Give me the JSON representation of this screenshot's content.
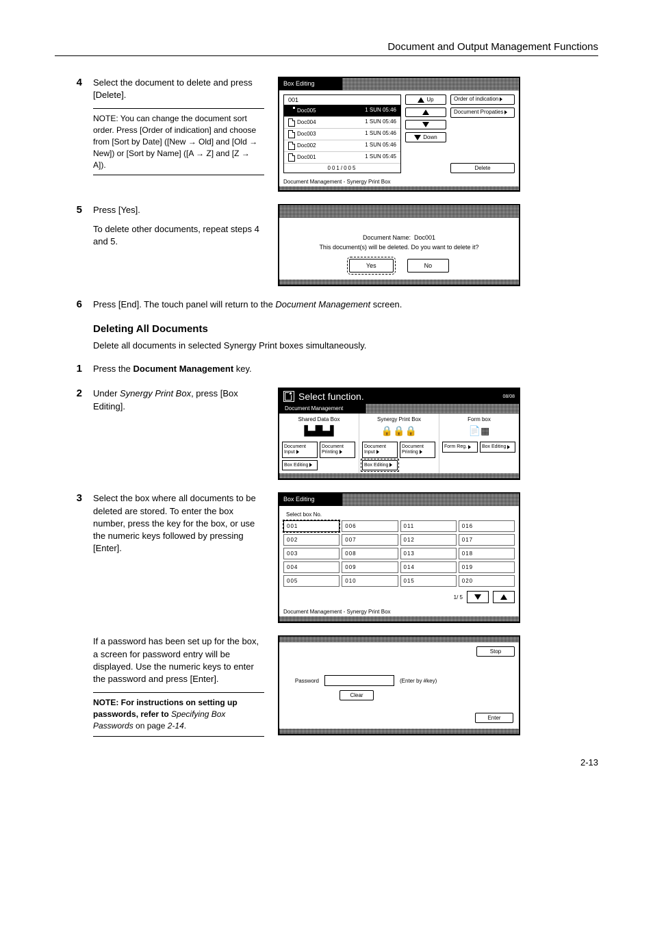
{
  "header": {
    "title": "Document and Output Management Functions"
  },
  "steps": {
    "s4": {
      "num": "4",
      "text": "Select the document to delete and press [Delete].",
      "note": "NOTE: You can change the document sort order. Press [Order of indication] and choose from [Sort by Date] ([New → Old] and [Old → New]) or [Sort by Name] ([A → Z] and [Z → A])."
    },
    "s5": {
      "num": "5",
      "text1": "Press [Yes].",
      "text2": "To delete other documents, repeat steps 4 and 5."
    },
    "s6": {
      "num": "6",
      "text_a": "Press [End]. The touch panel will return to the ",
      "text_em": "Document Management",
      "text_b": " screen."
    },
    "sub_heading": "Deleting All Documents",
    "sub_desc": "Delete all documents in selected Synergy Print boxes simultaneously.",
    "d1": {
      "num": "1",
      "text_a": "Press the ",
      "text_b": "Document Management",
      "text_c": " key."
    },
    "d2": {
      "num": "2",
      "text_a": "Under ",
      "text_em": "Synergy Print Box",
      "text_b": ", press [Box Editing]."
    },
    "d3": {
      "num": "3",
      "text": "Select the box where all documents to be deleted are stored. To enter the box number, press the key for the box, or use the numeric keys followed by pressing [Enter]."
    },
    "d3b": {
      "text": "If a password has been set up for the box, a screen for password entry will be displayed. Use the numeric keys to enter the password and press [Enter].",
      "note_a": "NOTE: For instructions on setting up passwords, refer to ",
      "note_em": "Specifying Box Passwords",
      "note_b": " on page ",
      "note_pg": "2-14",
      "note_c": "."
    }
  },
  "page_num": "2-13",
  "panel1": {
    "title": "Box Editing",
    "list_head": "001",
    "rows": [
      {
        "name": "Doc005",
        "date": "1 SUN 05:46"
      },
      {
        "name": "Doc004",
        "date": "1 SUN 05:46"
      },
      {
        "name": "Doc003",
        "date": "1 SUN 05:46"
      },
      {
        "name": "Doc002",
        "date": "1 SUN 05:46"
      },
      {
        "name": "Doc001",
        "date": "1 SUN 05:45"
      }
    ],
    "counter": "001/005",
    "up": "Up",
    "down": "Down",
    "order": "Order of indication",
    "props": "Document Propaties",
    "delete": "Delete",
    "footer": "Document Management    -    Synergy Print Box"
  },
  "panel2": {
    "name_label": "Document Name:",
    "name_value": "Doc001",
    "msg": "This document(s) will be deleted. Do you want to delete it?",
    "yes": "Yes",
    "no": "No"
  },
  "panel3": {
    "title": "Select function.",
    "date": "08/08",
    "tab": "Document Management",
    "cols": [
      {
        "title": "Shared Data Box",
        "buttons": [
          "Document Input",
          "Document Printing",
          "Box Editing"
        ]
      },
      {
        "title": "Synergy Print Box",
        "buttons": [
          "Document Input",
          "Document Printing",
          "Box Editing"
        ]
      },
      {
        "title": "Form box",
        "buttons": [
          "Form Reg.",
          "Box Editing"
        ]
      }
    ]
  },
  "panel4": {
    "title": "Box Editing",
    "label": "Select box No.",
    "cells": [
      "001",
      "006",
      "011",
      "016",
      "002",
      "007",
      "012",
      "017",
      "003",
      "008",
      "013",
      "018",
      "004",
      "009",
      "014",
      "019",
      "005",
      "010",
      "015",
      "020"
    ],
    "page": "1/ 5",
    "footer": "Document Management   -   Synergy Print Box"
  },
  "panel5": {
    "stop": "Stop",
    "pw_label": "Password",
    "hint": "(Enter by #key)",
    "clear": "Clear",
    "enter": "Enter"
  }
}
